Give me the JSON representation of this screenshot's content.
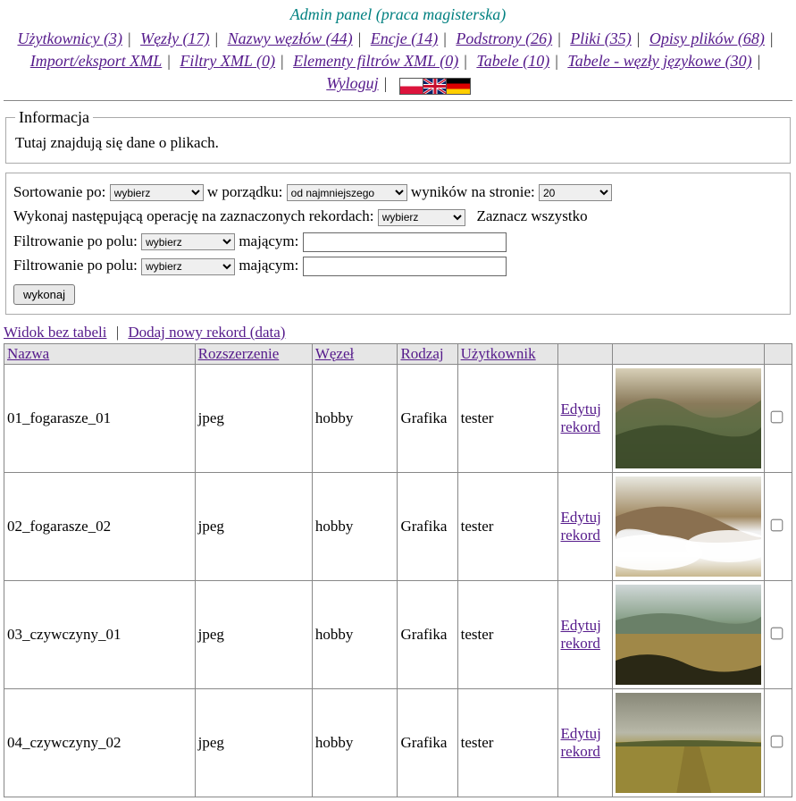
{
  "title": "Admin panel (praca magisterska)",
  "nav": [
    {
      "label": "Użytkownicy (3)"
    },
    {
      "label": "Węzły (17)"
    },
    {
      "label": "Nazwy węzłów (44)"
    },
    {
      "label": "Encje (14)"
    },
    {
      "label": "Podstrony (26)"
    },
    {
      "label": "Pliki (35)"
    },
    {
      "label": "Opisy plików (68)"
    },
    {
      "label": "Import/eksport XML"
    },
    {
      "label": "Filtry XML (0)"
    },
    {
      "label": "Elementy filtrów XML (0)"
    },
    {
      "label": "Tabele (10)"
    },
    {
      "label": "Tabele - węzły językowe (30)"
    },
    {
      "label": "Wyloguj"
    }
  ],
  "info": {
    "legend": "Informacja",
    "text": "Tutaj znajdują się dane o plikach."
  },
  "filters": {
    "sort_label": "Sortowanie po:",
    "sort_value": "wybierz",
    "order_label": "w porządku:",
    "order_value": "od najmniejszego",
    "perpage_label": "wyników na stronie:",
    "perpage_value": "20",
    "operation_label": "Wykonaj następującą operację na zaznaczonych rekordach:",
    "operation_value": "wybierz",
    "select_all": "Zaznacz wszystko",
    "filter_label": "Filtrowanie po polu:",
    "filter_value": "wybierz",
    "having_label": "mającym:",
    "execute": "wykonaj"
  },
  "table_actions": {
    "no_table_view": "Widok bez tabeli",
    "add_record": "Dodaj nowy rekord (data)"
  },
  "columns": {
    "nazwa": "Nazwa",
    "ext": "Rozszerzenie",
    "wezel": "Węzeł",
    "rodzaj": "Rodzaj",
    "user": "Użytkownik"
  },
  "edit_label": "Edytuj rekord",
  "rows": [
    {
      "nazwa": "01_fogarasze_01",
      "ext": "jpeg",
      "wezel": "hobby",
      "rodzaj": "Grafika",
      "user": "tester",
      "bg": "mountain1"
    },
    {
      "nazwa": "02_fogarasze_02",
      "ext": "jpeg",
      "wezel": "hobby",
      "rodzaj": "Grafika",
      "user": "tester",
      "bg": "mountain2"
    },
    {
      "nazwa": "03_czywczyny_01",
      "ext": "jpeg",
      "wezel": "hobby",
      "rodzaj": "Grafika",
      "user": "tester",
      "bg": "mountain3"
    },
    {
      "nazwa": "04_czywczyny_02",
      "ext": "jpeg",
      "wezel": "hobby",
      "rodzaj": "Grafika",
      "user": "tester",
      "bg": "mountain4"
    }
  ]
}
